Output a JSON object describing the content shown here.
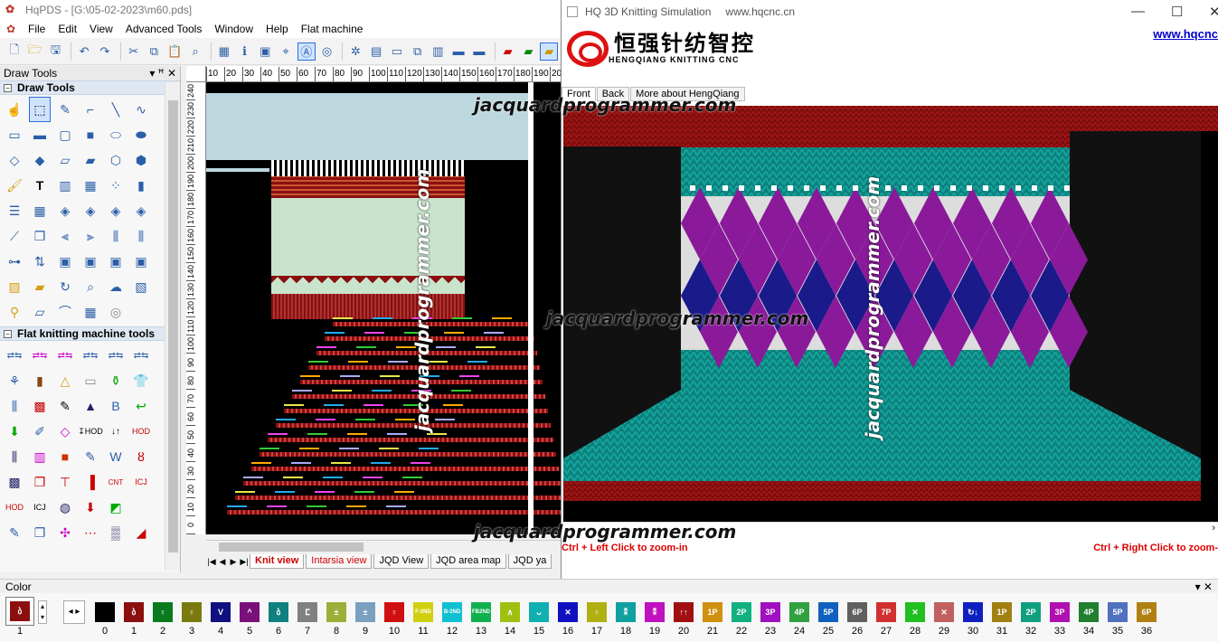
{
  "main_window": {
    "title": "HqPDS - [G:\\05-02-2023\\m60.pds]",
    "menu": [
      "File",
      "Edit",
      "View",
      "Advanced Tools",
      "Window",
      "Help",
      "Flat machine"
    ]
  },
  "left_panel": {
    "title": "Draw Tools",
    "pin_glyph": "▾ ꟸ ✕",
    "section_draw": "Draw Tools",
    "section_flat": "Flat knitting machine tools"
  },
  "ruler_h": [
    "10",
    "20",
    "30",
    "40",
    "50",
    "60",
    "70",
    "80",
    "90",
    "100",
    "110",
    "120",
    "130",
    "140",
    "150",
    "160",
    "170",
    "180",
    "190",
    "20"
  ],
  "ruler_v": [
    "240",
    "230",
    "220",
    "210",
    "200",
    "190",
    "180",
    "170",
    "160",
    "150",
    "140",
    "130",
    "120",
    "110",
    "100",
    "90",
    "80",
    "70",
    "60",
    "50",
    "40",
    "30",
    "20",
    "10",
    "0"
  ],
  "view_tabs": [
    "Knit view",
    "Intarsia view",
    "JQD View",
    "JQD area map",
    "JQD ya"
  ],
  "sim_window": {
    "title": "HQ 3D Knitting Simulation",
    "url": "www.hqcnc.cn",
    "brand_cn": "恒强针纺智控",
    "brand_en": "HENGQIANG KNITTING CNC",
    "weblink": "www.hqcnc",
    "tabs": [
      "Front",
      "Back",
      "More about HengQiang"
    ],
    "hint_left": "Ctrl + Left Click to zoom-in",
    "hint_right": "Ctrl + Right Click to zoom-"
  },
  "watermark": "jacquardprogrammer.com",
  "color_bar": {
    "title": "Color",
    "current_label": "1",
    "swatches": [
      {
        "n": "0",
        "c": "#000000",
        "g": ""
      },
      {
        "n": "1",
        "c": "#8b0f0f",
        "g": "ბ"
      },
      {
        "n": "2",
        "c": "#0a7a1e",
        "g": "♀"
      },
      {
        "n": "3",
        "c": "#7a7a10",
        "g": "♀"
      },
      {
        "n": "4",
        "c": "#101080",
        "g": "V"
      },
      {
        "n": "5",
        "c": "#7a107a",
        "g": "^"
      },
      {
        "n": "6",
        "c": "#108080",
        "g": "ბ"
      },
      {
        "n": "7",
        "c": "#808080",
        "g": "ⵎ"
      },
      {
        "n": "8",
        "c": "#9ab03a",
        "g": "±"
      },
      {
        "n": "9",
        "c": "#7aa0c0",
        "g": "±"
      },
      {
        "n": "10",
        "c": "#d01010",
        "g": "♀"
      },
      {
        "n": "11",
        "c": "#d0d010",
        "g": "F-2ND"
      },
      {
        "n": "12",
        "c": "#10c0d0",
        "g": "B-2ND"
      },
      {
        "n": "13",
        "c": "#10b050",
        "g": "FB2ND"
      },
      {
        "n": "14",
        "c": "#a0c010",
        "g": "∧"
      },
      {
        "n": "15",
        "c": "#10b0b0",
        "g": "ᴗ"
      },
      {
        "n": "16",
        "c": "#1010c0",
        "g": "✕"
      },
      {
        "n": "17",
        "c": "#b0b010",
        "g": "♀"
      },
      {
        "n": "18",
        "c": "#10a0a0",
        "g": "⁑"
      },
      {
        "n": "19",
        "c": "#c010c0",
        "g": "⁑"
      },
      {
        "n": "20",
        "c": "#a01010",
        "g": "↑↑"
      },
      {
        "n": "21",
        "c": "#d09010",
        "g": "1P"
      },
      {
        "n": "22",
        "c": "#10b080",
        "g": "2P"
      },
      {
        "n": "23",
        "c": "#a010c0",
        "g": "3P"
      },
      {
        "n": "24",
        "c": "#30a040",
        "g": "4P"
      },
      {
        "n": "25",
        "c": "#1060c0",
        "g": "5P"
      },
      {
        "n": "26",
        "c": "#606060",
        "g": "6P"
      },
      {
        "n": "27",
        "c": "#d03030",
        "g": "7P"
      },
      {
        "n": "28",
        "c": "#20c020",
        "g": "✕"
      },
      {
        "n": "29",
        "c": "#c06060",
        "g": "✕"
      },
      {
        "n": "30",
        "c": "#1020c0",
        "g": "↻↓"
      },
      {
        "n": "31",
        "c": "#a08010",
        "g": "1P"
      },
      {
        "n": "32",
        "c": "#10a080",
        "g": "2P"
      },
      {
        "n": "33",
        "c": "#b010b0",
        "g": "3P"
      },
      {
        "n": "34",
        "c": "#208030",
        "g": "4P"
      },
      {
        "n": "35",
        "c": "#5070c0",
        "g": "5P"
      },
      {
        "n": "36",
        "c": "#b08010",
        "g": "6P"
      }
    ]
  }
}
